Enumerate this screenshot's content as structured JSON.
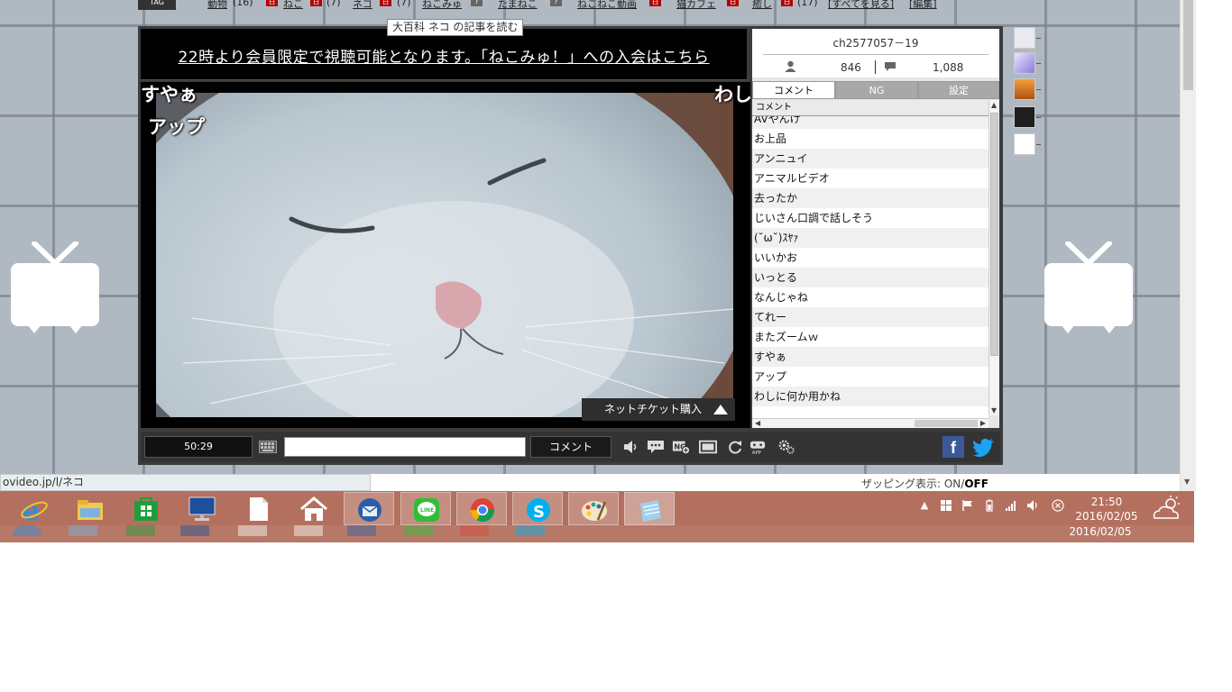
{
  "tagbar": {
    "icon_label": "TAG",
    "items": [
      {
        "label": "動物",
        "count": "(16)"
      },
      {
        "label": "ねこ",
        "count": "(7)"
      },
      {
        "label": "ネコ",
        "count": "(7)"
      },
      {
        "label": "ねこみゅ",
        "count": ""
      },
      {
        "label": "たまねこ",
        "count": ""
      },
      {
        "label": "ねこねこ動画",
        "count": ""
      },
      {
        "label": "猫カフェ",
        "count": ""
      },
      {
        "label": "癒し",
        "count": "(17)"
      }
    ],
    "see_all": "[すべてを見る]",
    "edit": "[編集]"
  },
  "tooltip": "大百科 ネコ の記事を読む",
  "notice": "22時より会員限定で視聴可能となります。「ねこみゅ！」への入会はこちら",
  "video": {
    "flow_comments": [
      {
        "text": "すやぁ"
      },
      {
        "text": "アップ"
      },
      {
        "text": "わし"
      }
    ],
    "ticket_button": "ネットチケット購入"
  },
  "panel": {
    "channel_id": "ch2577057－19",
    "viewers": "846",
    "comments_total": "1,088",
    "tabs": [
      "コメント",
      "NG",
      "設定"
    ],
    "list_header": "コメント",
    "comments": [
      "AVやんけ",
      "お上品",
      "アンニュイ",
      "アニマルビデオ",
      "去ったか",
      "じいさん口調で話しそう",
      "(˘ω˘)ｽﾔｧ",
      "いいかお",
      "いっとる",
      "なんじゃね",
      "てれー",
      "またズームｗ",
      "すやぁ",
      "アップ",
      "わしに何か用かね"
    ]
  },
  "controls": {
    "time": "50:29",
    "comment_input_value": "",
    "comment_button": "コメント",
    "facebook_label": "f"
  },
  "status": {
    "url": "ovideo.jp/l/ネコ",
    "zapping_label": "ザッピング表示: ON/",
    "zapping_off": "OFF"
  },
  "taskbar": {
    "apps": [
      "internet-explorer",
      "file-explorer",
      "windows-store",
      "lenovo",
      "document",
      "home",
      "thunderbird",
      "line",
      "chrome",
      "skype",
      "paint",
      "notepad"
    ],
    "time": "21:50",
    "date": "2016/02/05"
  },
  "colors": {
    "taskbar": "#b4705e",
    "facebook": "#3b5998",
    "twitter": "#1da1f2",
    "tag_icon": "#b20000"
  }
}
